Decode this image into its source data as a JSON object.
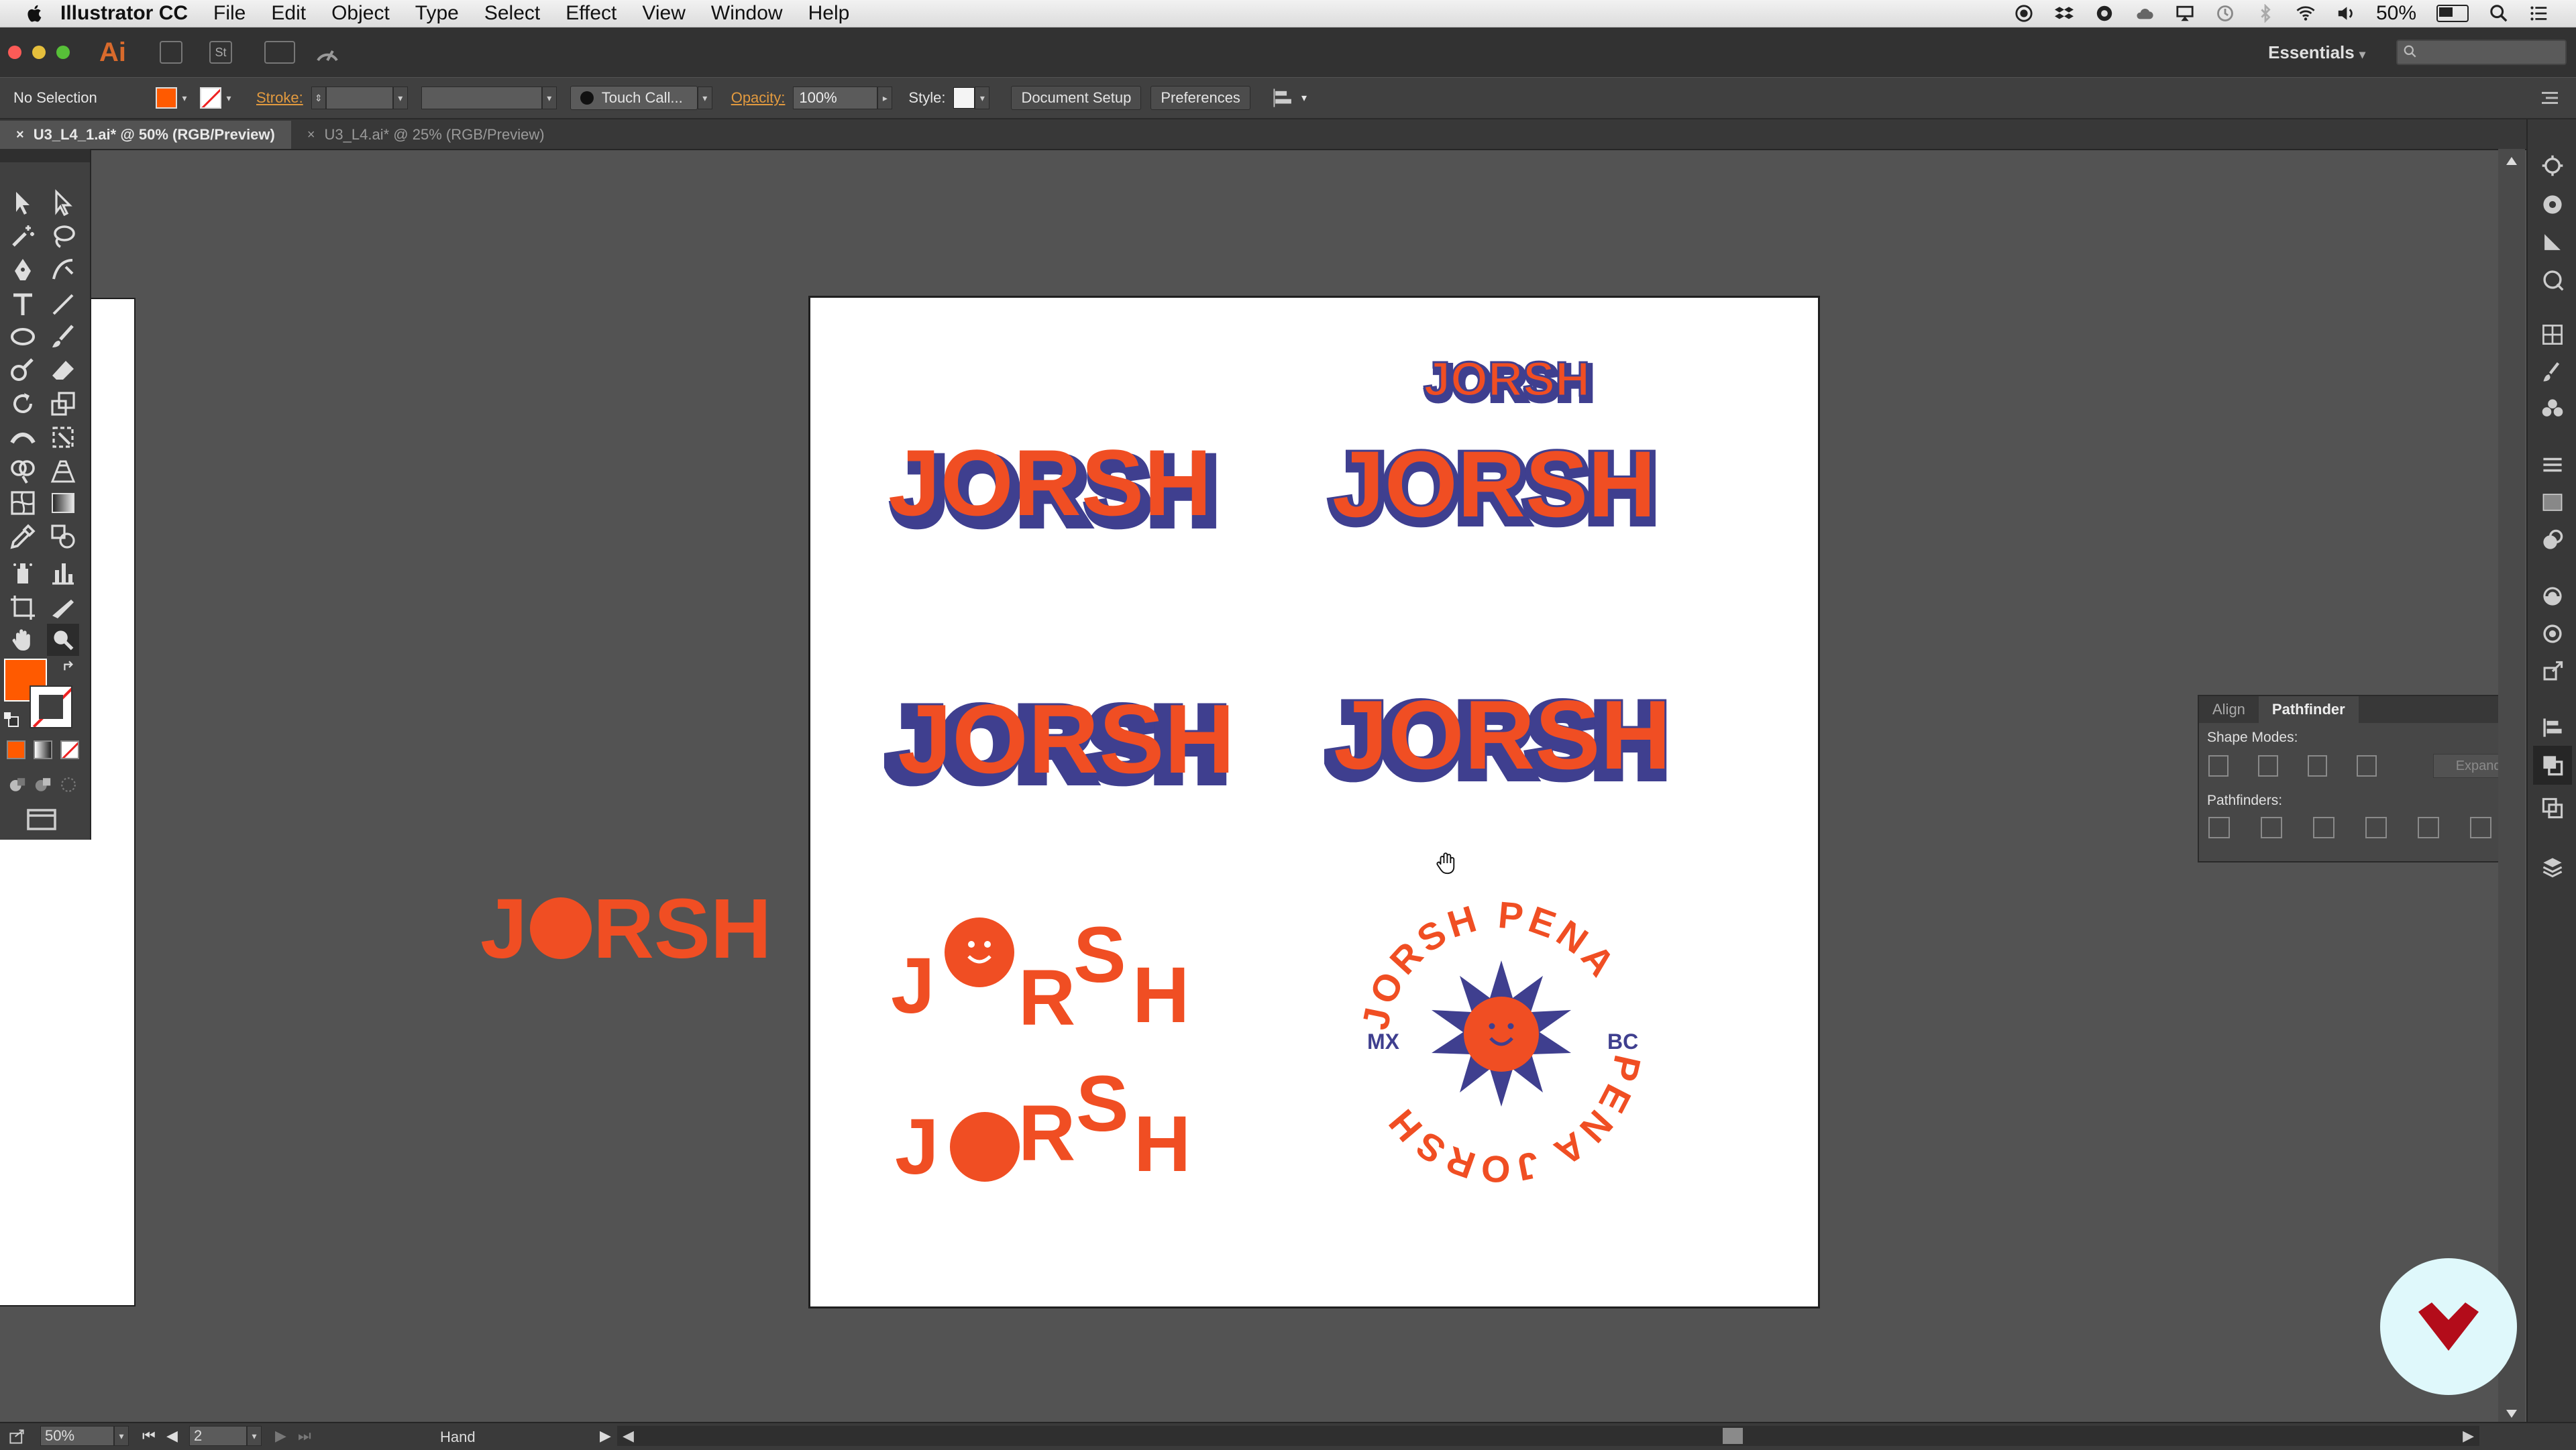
{
  "menubar": {
    "app": "Illustrator CC",
    "items": [
      "File",
      "Edit",
      "Object",
      "Type",
      "Select",
      "Effect",
      "View",
      "Window",
      "Help"
    ],
    "battery": "50%"
  },
  "titlebar": {
    "logo": "Ai",
    "bridge": "St",
    "workspace": "Essentials",
    "workspace_arrow": "▾"
  },
  "control": {
    "selection": "No Selection",
    "stroke_label": "Stroke:",
    "brush": "Touch Call...",
    "opacity_label": "Opacity:",
    "opacity_value": "100%",
    "style_label": "Style:",
    "document_setup": "Document Setup",
    "preferences": "Preferences"
  },
  "tabs": [
    {
      "label": "U3_L4_1.ai* @ 50% (RGB/Preview)",
      "close": "×"
    },
    {
      "label": "U3_L4.ai* @ 25% (RGB/Preview)",
      "close": "×"
    }
  ],
  "pathfinder": {
    "tabs": [
      "Align",
      "Pathfinder"
    ],
    "shape_modes": "Shape Modes:",
    "expand": "Expand",
    "pathfinders": "Pathfinders:"
  },
  "artwork": {
    "word": "JORSH",
    "word_parts": {
      "j": "J",
      "rsh": "RSH",
      "r": "R",
      "s": "S",
      "h": "H"
    },
    "badge_top": "JORSH PENA",
    "badge_bottom": "PENA JORSH",
    "badge_left": "MX",
    "badge_right": "BC"
  },
  "status": {
    "zoom": "50%",
    "artboard": "2",
    "tool": "Hand"
  },
  "colors": {
    "accent_orange": "#f04e23",
    "accent_navy": "#3f3f8f",
    "fill_swatch": "#ff5a00"
  }
}
